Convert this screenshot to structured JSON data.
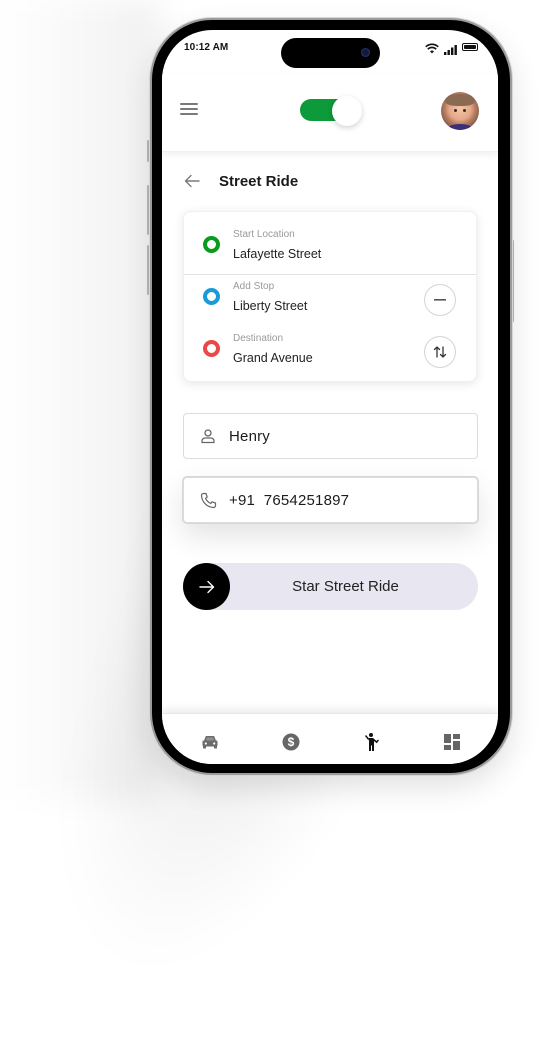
{
  "status_bar": {
    "time": "10:12 AM",
    "icons": [
      "wifi-icon",
      "signal-icon",
      "battery-icon"
    ]
  },
  "header": {
    "menu_icon": "hamburger-menu-icon",
    "toggle": {
      "state": "on",
      "color": "#0d9a3a"
    },
    "avatar": "user-avatar"
  },
  "page": {
    "back_icon": "arrow-left-icon",
    "title": "Street Ride"
  },
  "route": {
    "stops": [
      {
        "label": "Start Location",
        "value": "Lafayette Street",
        "color": "#0a9a1e",
        "action": null
      },
      {
        "label": "Add Stop",
        "value": "Liberty Street",
        "color": "#1a9ad6",
        "action": "remove-stop"
      },
      {
        "label": "Destination",
        "value": "Grand Avenue",
        "color": "#e84a4a",
        "action": "swap-locations"
      }
    ]
  },
  "form": {
    "name": {
      "icon": "person-icon",
      "value": "Henry"
    },
    "phone": {
      "icon": "phone-icon",
      "value": "+91  7654251897"
    }
  },
  "slide_button": {
    "icon": "arrow-right-icon",
    "label": "Star Street Ride"
  },
  "bottom_nav": {
    "items": [
      {
        "icon": "car-icon",
        "active": false
      },
      {
        "icon": "dollar-icon",
        "active": false
      },
      {
        "icon": "person-waving-icon",
        "active": true
      },
      {
        "icon": "dashboard-icon",
        "active": false
      }
    ]
  }
}
